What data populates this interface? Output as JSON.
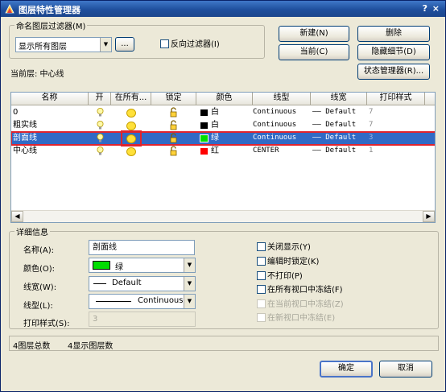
{
  "window": {
    "title": "图层特性管理器",
    "help": "?",
    "close": "×"
  },
  "filter_group": {
    "title": "命名图层过滤器(M)",
    "selected": "显示所有图层",
    "more_button": "...",
    "invert_label": "反向过滤器(I)"
  },
  "buttons": {
    "new": "新建(N)",
    "delete": "删除",
    "current": "当前(C)",
    "hide_details": "隐藏细节(D)",
    "state_manager": "状态管理器(R)...",
    "ok": "确定",
    "cancel": "取消"
  },
  "current_layer": "当前层: 中心线",
  "table": {
    "headers": [
      "名称",
      "开",
      "在所有...",
      "锁定",
      "颜色",
      "线型",
      "线宽",
      "打印样式"
    ],
    "rows": [
      {
        "name": "0",
        "color_name": "白",
        "color": "#000000",
        "linetype": "Continuous",
        "lineweight": "—— Default",
        "plot": "7"
      },
      {
        "name": "粗实线",
        "color_name": "白",
        "color": "#000000",
        "linetype": "Continuous",
        "lineweight": "—— Default",
        "plot": "7"
      },
      {
        "name": "剖面线",
        "color_name": "绿",
        "color": "#00dd00",
        "linetype": "Continuous",
        "lineweight": "—— Default",
        "plot": "3"
      },
      {
        "name": "中心线",
        "color_name": "红",
        "color": "#ff0000",
        "linetype": "CENTER",
        "lineweight": "—— Default",
        "plot": "1"
      }
    ]
  },
  "details": {
    "title": "详细信息",
    "name_label": "名称(A):",
    "name_value": "剖面线",
    "color_label": "颜色(O):",
    "color_value": "绿",
    "color_hex": "#00dd00",
    "lineweight_label": "线宽(W):",
    "lineweight_value": "Default",
    "linetype_label": "线型(L):",
    "linetype_value": "Continuous",
    "plotstyle_label": "打印样式(S):",
    "plotstyle_value": "3",
    "checks": {
      "off": "关闭显示(Y)",
      "lock_edit": "编辑时锁定(K)",
      "no_plot": "不打印(P)",
      "freeze_all": "在所有视口中冻结(F)",
      "freeze_current": "在当前视口中冻结(Z)",
      "freeze_new": "在新视口中冻结(E)"
    }
  },
  "status": {
    "total": "4图层总数",
    "shown": "4显示图层数"
  }
}
